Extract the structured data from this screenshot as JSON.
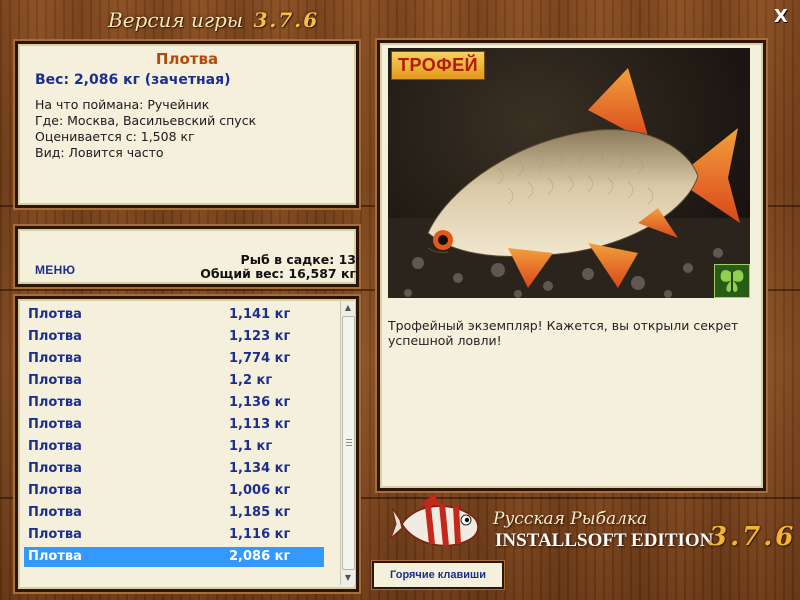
{
  "window": {
    "title": "Версия игры",
    "version": "3.7.6",
    "close_label": "X"
  },
  "info": {
    "fish_name": "Плотва",
    "weight_line": "Вес: 2,086 кг (зачетная)",
    "lines": [
      "На что поймана: Ручейник",
      "Где: Москва, Васильевский спуск",
      "Оценивается с: 1,508 кг",
      "Вид: Ловится часто"
    ]
  },
  "menu": {
    "menu_label": "МЕНЮ",
    "fish_count": "Рыб в садке: 13",
    "total_weight": "Общий вес: 16,587 кг"
  },
  "catch_list": [
    {
      "name": "Плотва",
      "weight": "1,141 кг"
    },
    {
      "name": "Плотва",
      "weight": "1,123 кг"
    },
    {
      "name": "Плотва",
      "weight": "1,774 кг"
    },
    {
      "name": "Плотва",
      "weight": "1,2 кг"
    },
    {
      "name": "Плотва",
      "weight": "1,136 кг"
    },
    {
      "name": "Плотва",
      "weight": "1,113 кг"
    },
    {
      "name": "Плотва",
      "weight": "1,1 кг"
    },
    {
      "name": "Плотва",
      "weight": "1,134 кг"
    },
    {
      "name": "Плотва",
      "weight": "1,006 кг"
    },
    {
      "name": "Плотва",
      "weight": "1,185 кг"
    },
    {
      "name": "Плотва",
      "weight": "1,116 кг"
    },
    {
      "name": "Плотва",
      "weight": "2,086 кг",
      "selected": true
    }
  ],
  "photo": {
    "badge": "ТРОФЕЙ",
    "description": "Трофейный экземпляр! Кажется, вы открыли секрет успешной ловли!"
  },
  "footer": {
    "hotkeys_label": "Горячие клавиши",
    "logo_line1": "Русская Рыбалка",
    "logo_line2": "INSTALLSOFT EDITION",
    "logo_version": "3.7.6"
  },
  "colors": {
    "accent_blue": "#1d2f8d",
    "title_orange": "#b4490d",
    "selection": "#3399ff"
  }
}
